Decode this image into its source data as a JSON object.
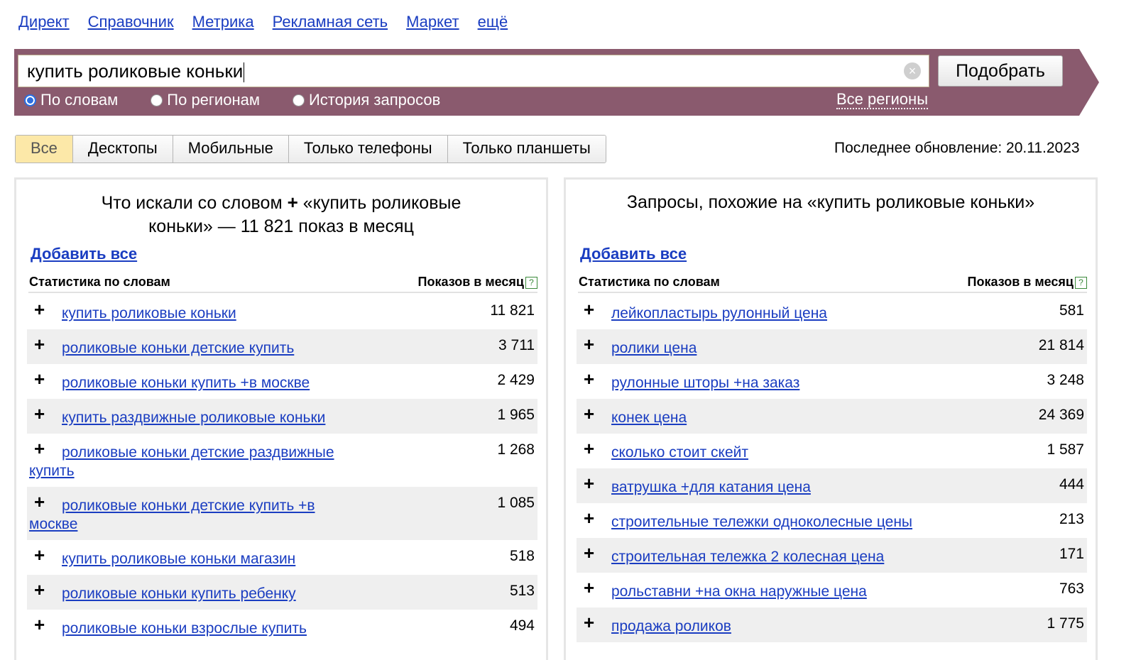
{
  "nav": [
    "Директ",
    "Справочник",
    "Метрика",
    "Рекламная сеть",
    "Маркет",
    "ещё"
  ],
  "search": {
    "query": "купить роликовые коньки",
    "button": "Подобрать"
  },
  "modes": [
    {
      "label": "По словам",
      "selected": true
    },
    {
      "label": "По регионам",
      "selected": false
    },
    {
      "label": "История запросов",
      "selected": false
    }
  ],
  "regions_link": "Все регионы",
  "device_tabs": [
    "Все",
    "Десктопы",
    "Мобильные",
    "Только телефоны",
    "Только планшеты"
  ],
  "active_tab": "Все",
  "last_update": "Последнее обновление: 20.11.2023",
  "colors": {
    "band": "#8a5a6e",
    "link": "#1a3dc1",
    "active_tab": "#fce8a8",
    "row_stripe": "#efefef"
  },
  "left": {
    "title_a": "Что искали со словом",
    "title_b": "«купить роликовые",
    "title_c": "коньки» — 11 821 показ в месяц",
    "add_all": "Добавить все",
    "col1": "Статистика по словам",
    "col2": "Показов в месяц",
    "rows": [
      {
        "q": "купить роликовые коньки",
        "n": "11 821"
      },
      {
        "q": "роликовые коньки детские купить",
        "n": "3 711"
      },
      {
        "q": "роликовые коньки купить +в москве",
        "n": "2 429"
      },
      {
        "q": "купить раздвижные роликовые коньки",
        "n": "1 965"
      },
      {
        "q": "роликовые коньки детские раздвижные купить",
        "n": "1 268"
      },
      {
        "q": "роликовые коньки детские купить +в москве",
        "n": "1 085"
      },
      {
        "q": "купить роликовые коньки магазин",
        "n": "518"
      },
      {
        "q": "роликовые коньки купить ребенку",
        "n": "513"
      },
      {
        "q": "роликовые коньки взрослые купить",
        "n": "494"
      }
    ]
  },
  "right": {
    "title": "Запросы, похожие на «купить роликовые коньки»",
    "add_all": "Добавить все",
    "col1": "Статистика по словам",
    "col2": "Показов в месяц",
    "rows": [
      {
        "q": "лейкопластырь рулонный цена",
        "n": "581"
      },
      {
        "q": "ролики цена",
        "n": "21 814"
      },
      {
        "q": "рулонные шторы +на заказ",
        "n": "3 248"
      },
      {
        "q": "конек цена",
        "n": "24 369"
      },
      {
        "q": "сколько стоит скейт",
        "n": "1 587"
      },
      {
        "q": "ватрушка +для катания цена",
        "n": "444"
      },
      {
        "q": "строительные тележки одноколесные цены",
        "n": "213"
      },
      {
        "q": "строительная тележка 2 колесная цена",
        "n": "171"
      },
      {
        "q": "рольставни +на окна наружные цена",
        "n": "763"
      },
      {
        "q": "продажа роликов",
        "n": "1 775"
      }
    ]
  }
}
